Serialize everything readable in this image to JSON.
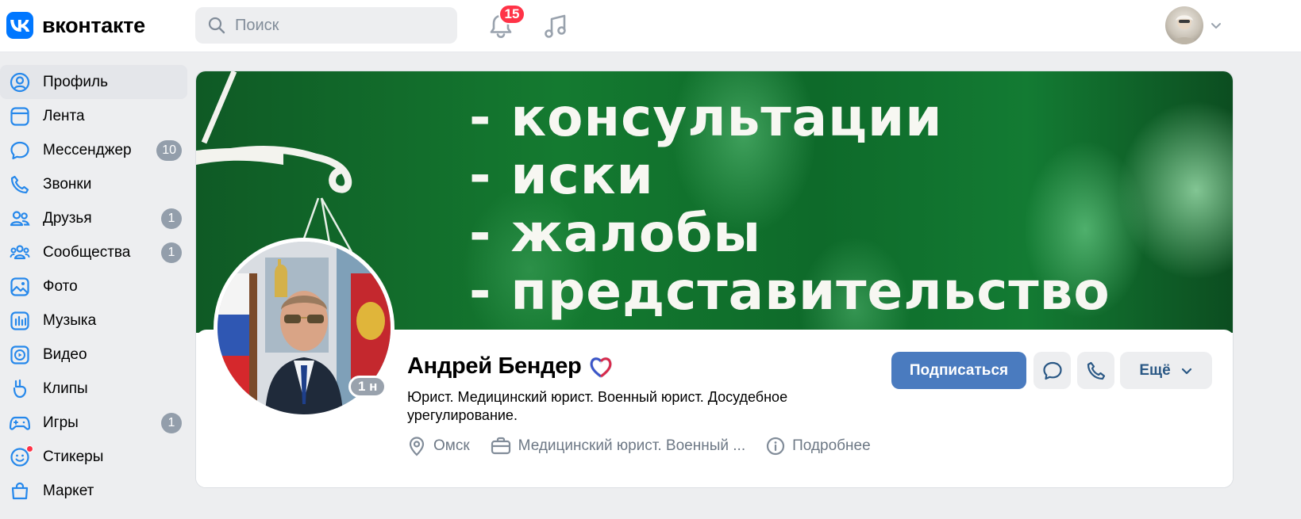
{
  "header": {
    "logo_text": "вконтакте",
    "search_placeholder": "Поиск",
    "notifications_count": "15"
  },
  "sidebar": {
    "items": [
      {
        "label": "Профиль",
        "icon": "profile-icon",
        "active": true
      },
      {
        "label": "Лента",
        "icon": "feed-icon"
      },
      {
        "label": "Мессенджер",
        "icon": "messenger-icon",
        "count": "10"
      },
      {
        "label": "Звонки",
        "icon": "phone-icon"
      },
      {
        "label": "Друзья",
        "icon": "friends-icon",
        "count": "1"
      },
      {
        "label": "Сообщества",
        "icon": "communities-icon",
        "count": "1"
      },
      {
        "label": "Фото",
        "icon": "photo-icon"
      },
      {
        "label": "Музыка",
        "icon": "music-icon"
      },
      {
        "label": "Видео",
        "icon": "video-icon"
      },
      {
        "label": "Клипы",
        "icon": "clips-icon"
      },
      {
        "label": "Игры",
        "icon": "games-icon",
        "count": "1"
      },
      {
        "label": "Стикеры",
        "icon": "stickers-icon",
        "dot": true
      },
      {
        "label": "Маркет",
        "icon": "market-icon"
      }
    ]
  },
  "cover": {
    "lines": [
      "- консультации",
      "- иски",
      "- жалобы",
      "- представительство"
    ]
  },
  "profile": {
    "name": "Андрей Бендер",
    "online_badge": "1 н",
    "status": "Юрист. Медицинский юрист. Военный юрист. Досудебное урегулирование.",
    "city": "Омск",
    "work": "Медицинский юрист. Военный ...",
    "more_info": "Подробнее"
  },
  "actions": {
    "subscribe": "Подписаться",
    "more": "Ещё"
  },
  "colors": {
    "brand": "#0077ff",
    "primary_button": "#4a7bbf",
    "badge_red": "#ff3347",
    "counter_gray": "#939eab"
  }
}
